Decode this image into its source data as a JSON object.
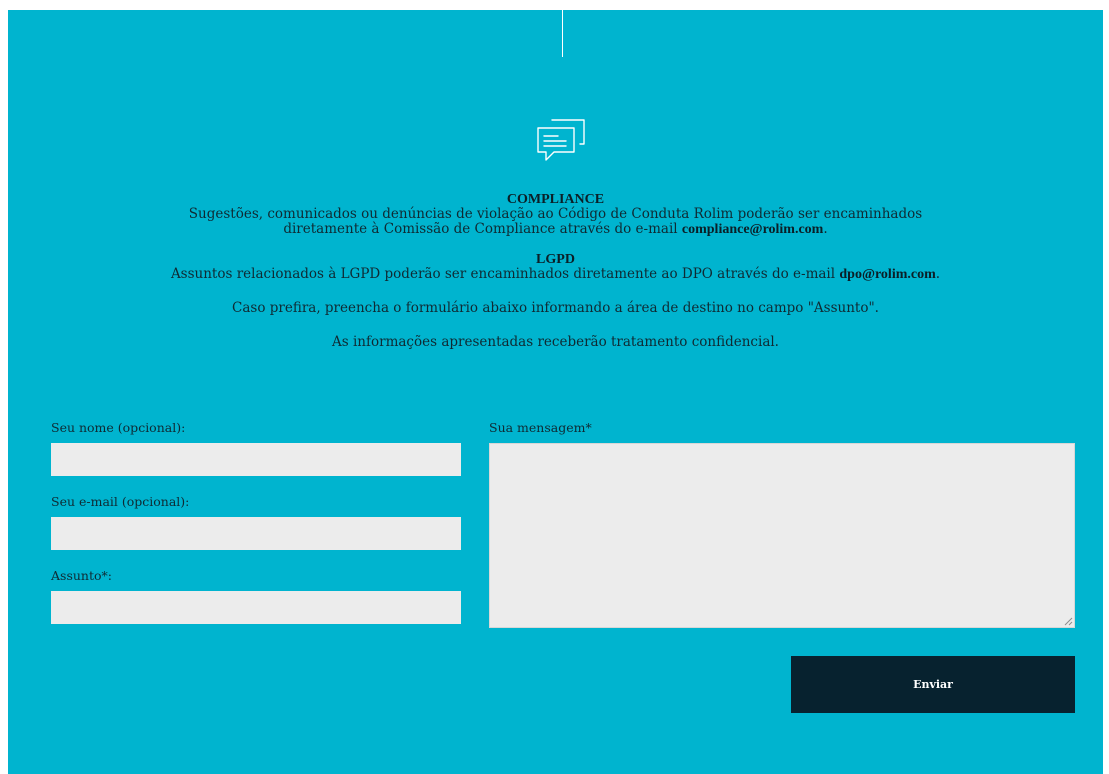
{
  "intro": {
    "compliance_heading": "COMPLIANCE",
    "compliance_text": "Sugestões, comunicados ou denúncias de violação ao Código de Conduta Rolim poderão ser encaminhados diretamente à Comissão de Compliance através do e-mail",
    "compliance_email": "compliance@rolim.com",
    "lgpd_heading": "LGPD",
    "lgpd_text": "Assuntos relacionados à LGPD poderão ser encaminhados diretamente ao DPO através do e-mail",
    "lgpd_email": "dpo@rolim.com",
    "period": ".",
    "form_instruction": "Caso prefira, preencha o formulário abaixo informando a área de destino no campo \"Assunto\".",
    "confidential_note": "As informações apresentadas receberão tratamento confidencial."
  },
  "form": {
    "name_label": "Seu nome (opcional):",
    "name_value": "",
    "email_label": "Seu e-mail (opcional):",
    "email_value": "",
    "subject_label": "Assunto*:",
    "subject_value": "",
    "message_label": "Sua mensagem*",
    "message_value": "",
    "submit_label": "Enviar"
  },
  "icons": {
    "header_icon": "chat-bubbles-icon",
    "grip_icon": "resize-grip-icon"
  },
  "colors": {
    "background": "#00b4cf",
    "input_background": "#ececec",
    "button_background": "#07222f",
    "text": "#0f2a33"
  }
}
